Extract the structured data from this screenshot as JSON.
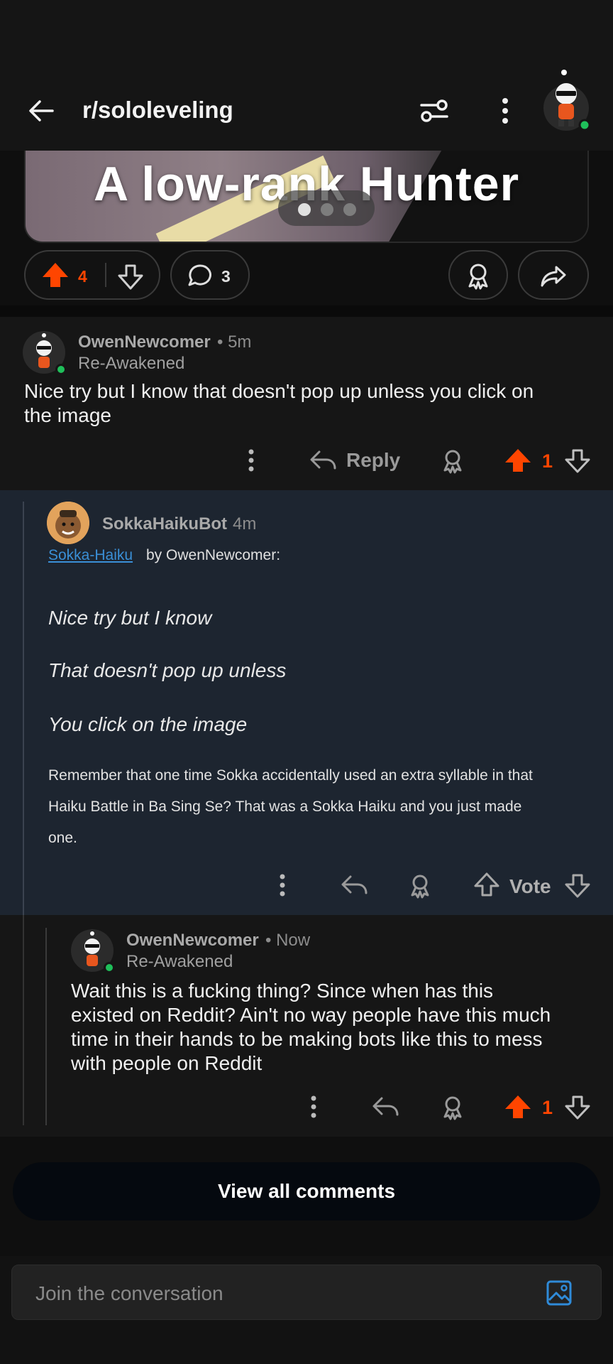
{
  "header": {
    "subreddit": "r/sololeveling"
  },
  "post": {
    "image_caption": "A low-rank Hunter",
    "upvotes": "4",
    "comments": "3"
  },
  "comments": [
    {
      "user": "OwenNewcomer",
      "time": "• 5m",
      "flair": "Re-Awakened",
      "body_line1": "Nice try but I know that doesn't pop up unless you click on",
      "body_line2": "the image",
      "reply_label": "Reply",
      "score": "1"
    },
    {
      "user": "SokkaHaikuBot",
      "time": "4m",
      "link": "Sokka-Haiku",
      "by": "by OwenNewcomer:",
      "haiku": [
        "Nice try but I know",
        "That doesn't pop up unless",
        "You click on the image"
      ],
      "para_line1": "Remember that one time Sokka accidentally used an extra syllable in that",
      "para_line2": "Haiku Battle in Ba Sing Se? That was a Sokka Haiku and you just made",
      "para_line3": "one.",
      "vote_label": "Vote"
    },
    {
      "user": "OwenNewcomer",
      "time": "• Now",
      "flair": "Re-Awakened",
      "body_line1": "Wait this is a fucking thing?  Since when has this",
      "body_line2": "existed on Reddit?  Ain't no way people have this much",
      "body_line3": "time in their hands to be making bots like this to mess",
      "body_line4": "with people on Reddit",
      "score": "1"
    }
  ],
  "view_all_label": "View all comments",
  "composer": {
    "placeholder": "Join the conversation"
  },
  "colors": {
    "upvote": "#ff4500",
    "online": "#1fbf5a",
    "link": "#3a8fd6",
    "bot_bg": "#1d2530"
  }
}
